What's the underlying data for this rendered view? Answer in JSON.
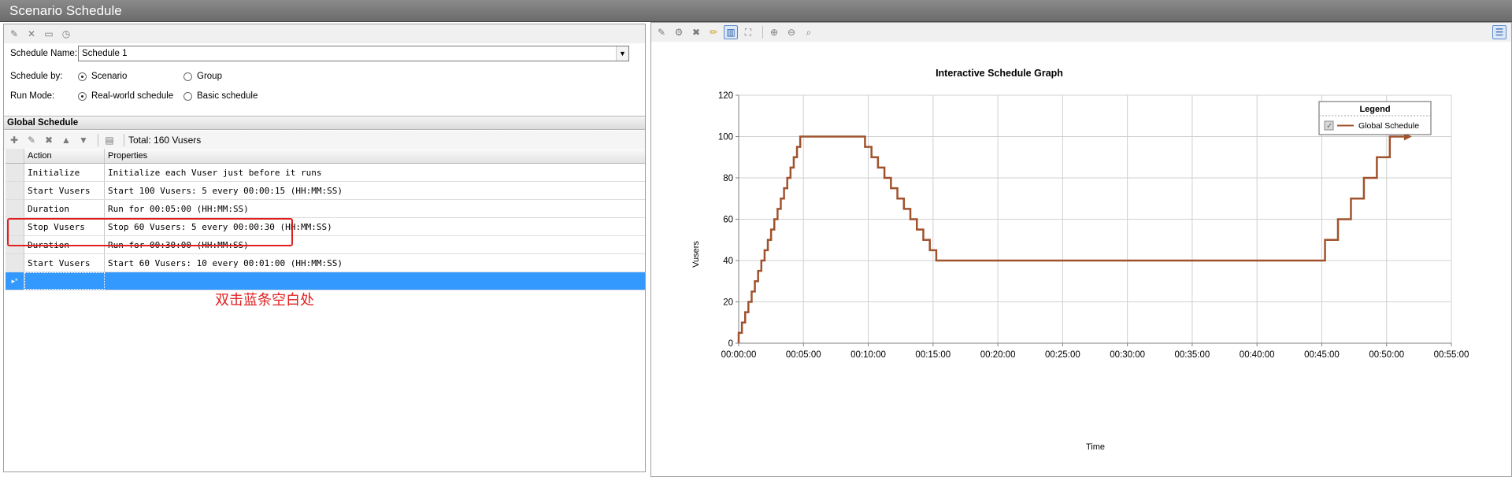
{
  "window": {
    "title": "Scenario Schedule"
  },
  "left_toolbar": {
    "icons": [
      "new-schedule-icon",
      "delete-icon",
      "rename-icon",
      "schedule-time-icon"
    ]
  },
  "form": {
    "schedule_name_label": "Schedule Name:",
    "schedule_name_value": "Schedule 1",
    "schedule_by_label": "Schedule by:",
    "schedule_by_options": [
      "Scenario",
      "Group"
    ],
    "schedule_by_selected": "Scenario",
    "run_mode_label": "Run Mode:",
    "run_mode_options": [
      "Real-world schedule",
      "Basic schedule"
    ],
    "run_mode_selected": "Real-world schedule"
  },
  "global_schedule": {
    "title": "Global Schedule",
    "total_label": "Total: 160 Vusers",
    "columns": [
      "Action",
      "Properties"
    ],
    "rows": [
      {
        "action": "Initialize",
        "properties": "Initialize each Vuser just before it runs"
      },
      {
        "action": "Start  Vusers",
        "properties": "Start 100 Vusers: 5 every 00:00:15 (HH:MM:SS)"
      },
      {
        "action": "Duration",
        "properties": "Run for 00:05:00 (HH:MM:SS)"
      },
      {
        "action": "Stop Vusers",
        "properties": "Stop 60 Vusers: 5 every 00:00:30 (HH:MM:SS)"
      },
      {
        "action": "Duration",
        "properties": "Run for 00:30:00 (HH:MM:SS)"
      },
      {
        "action": "Start  Vusers",
        "properties": "Start 60 Vusers: 10 every 00:01:00 (HH:MM:SS)"
      }
    ],
    "new_row_marker": "▸*"
  },
  "annotation": {
    "text": "双击蓝条空白处",
    "color": "#e02020"
  },
  "colors": {
    "series": "#a0522d",
    "selection": "#3399ff",
    "highlight": "#e02020"
  },
  "chart_data": {
    "type": "line",
    "title": "Interactive Schedule Graph",
    "xlabel": "Time",
    "ylabel": "Vusers",
    "xlim": [
      "00:00:00",
      "00:55:00"
    ],
    "ylim": [
      0,
      120
    ],
    "x_tick_labels": [
      "00:00:00",
      "00:05:00",
      "00:10:00",
      "00:15:00",
      "00:20:00",
      "00:25:00",
      "00:30:00",
      "00:35:00",
      "00:40:00",
      "00:45:00",
      "00:50:00",
      "00:55:00"
    ],
    "y_tick_labels": [
      "0",
      "20",
      "40",
      "60",
      "80",
      "100",
      "120"
    ],
    "grid": true,
    "legend": {
      "title": "Legend",
      "placement": "top-right",
      "entries": [
        "Global Schedule"
      ]
    },
    "series": [
      {
        "name": "Global Schedule",
        "step": true,
        "x": [
          "00:00:00",
          "00:00:15",
          "00:00:30",
          "00:00:45",
          "00:01:00",
          "00:01:15",
          "00:01:30",
          "00:01:45",
          "00:02:00",
          "00:02:15",
          "00:02:30",
          "00:02:45",
          "00:03:00",
          "00:03:15",
          "00:03:30",
          "00:03:45",
          "00:04:00",
          "00:04:15",
          "00:04:30",
          "00:04:45",
          "00:09:45",
          "00:10:15",
          "00:10:45",
          "00:11:15",
          "00:11:45",
          "00:12:15",
          "00:12:45",
          "00:13:15",
          "00:13:45",
          "00:14:15",
          "00:14:45",
          "00:15:15",
          "00:45:15",
          "00:46:15",
          "00:47:15",
          "00:48:15",
          "00:49:15",
          "00:50:15"
        ],
        "y": [
          5,
          10,
          15,
          20,
          25,
          30,
          35,
          40,
          45,
          50,
          55,
          60,
          65,
          70,
          75,
          80,
          85,
          90,
          95,
          100,
          95,
          90,
          85,
          80,
          75,
          70,
          65,
          60,
          55,
          50,
          45,
          40,
          50,
          60,
          70,
          80,
          90,
          100
        ]
      }
    ]
  }
}
